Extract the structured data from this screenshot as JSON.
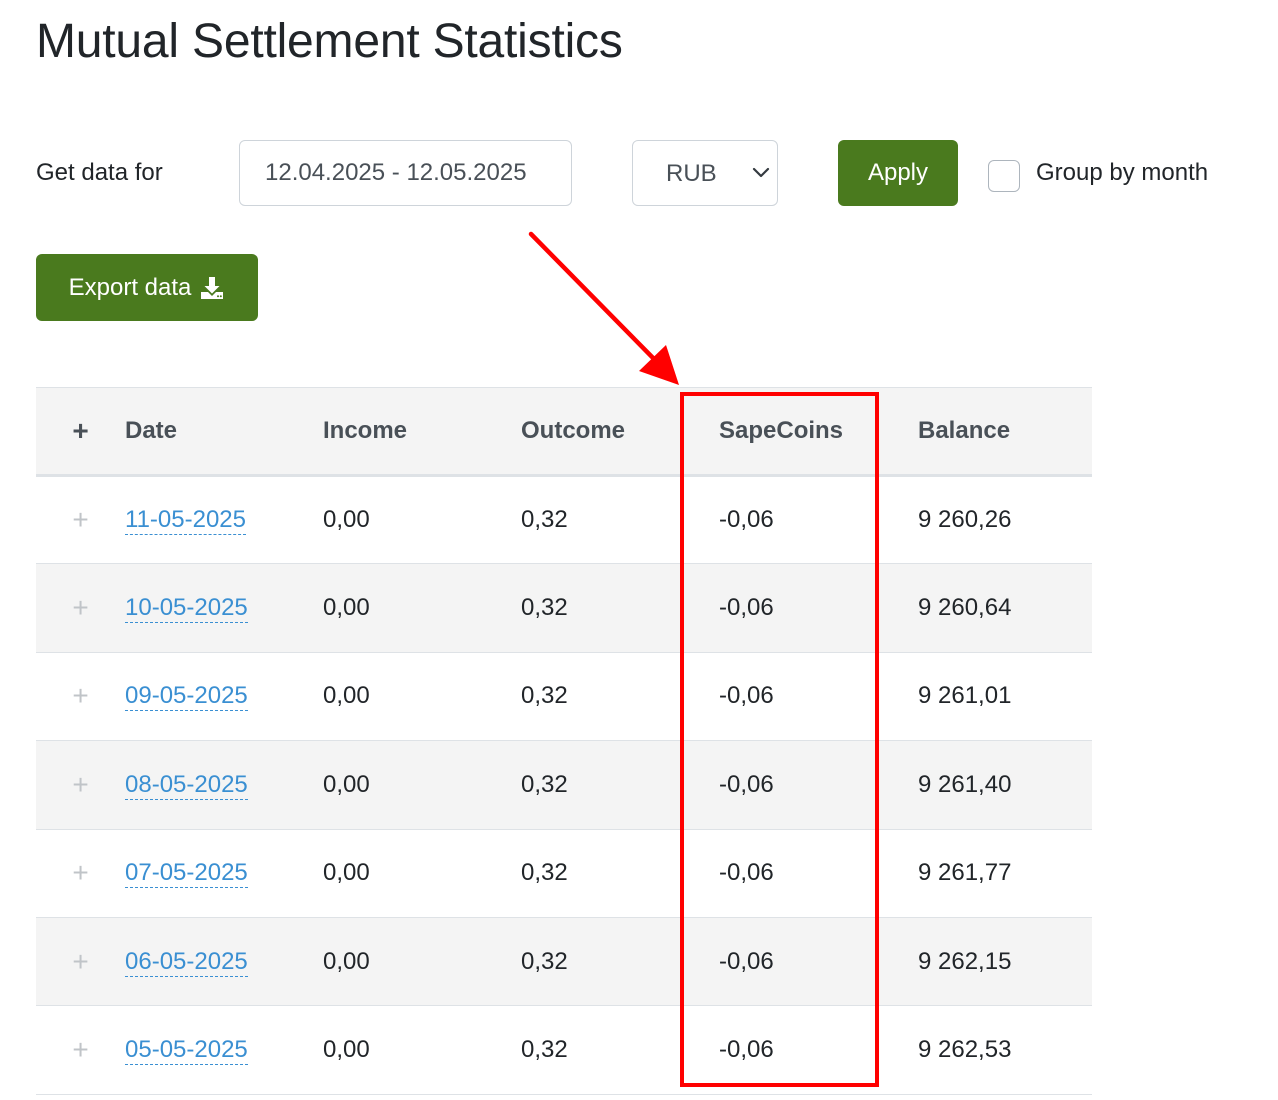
{
  "page": {
    "title": "Mutual Settlement Statistics"
  },
  "filters": {
    "label": "Get data for",
    "date_range": "12.04.2025 - 12.05.2025",
    "currency": "RUB",
    "apply_label": "Apply",
    "group_by_month_label": "Group by month",
    "group_by_month_checked": false
  },
  "export": {
    "label": "Export data",
    "icon": "download-icon"
  },
  "table": {
    "headers": {
      "expand": "+",
      "date": "Date",
      "income": "Income",
      "outcome": "Outcome",
      "sapecoins": "SapeCoins",
      "balance": "Balance"
    },
    "rows": [
      {
        "expand": "+",
        "date": "11-05-2025",
        "income": "0,00",
        "outcome": "0,32",
        "sapecoins": "-0,06",
        "balance": "9 260,26"
      },
      {
        "expand": "+",
        "date": "10-05-2025",
        "income": "0,00",
        "outcome": "0,32",
        "sapecoins": "-0,06",
        "balance": "9 260,64"
      },
      {
        "expand": "+",
        "date": "09-05-2025",
        "income": "0,00",
        "outcome": "0,32",
        "sapecoins": "-0,06",
        "balance": "9 261,01"
      },
      {
        "expand": "+",
        "date": "08-05-2025",
        "income": "0,00",
        "outcome": "0,32",
        "sapecoins": "-0,06",
        "balance": "9 261,40"
      },
      {
        "expand": "+",
        "date": "07-05-2025",
        "income": "0,00",
        "outcome": "0,32",
        "sapecoins": "-0,06",
        "balance": "9 261,77"
      },
      {
        "expand": "+",
        "date": "06-05-2025",
        "income": "0,00",
        "outcome": "0,32",
        "sapecoins": "-0,06",
        "balance": "9 262,15"
      },
      {
        "expand": "+",
        "date": "05-05-2025",
        "income": "0,00",
        "outcome": "0,32",
        "sapecoins": "-0,06",
        "balance": "9 262,53"
      }
    ]
  },
  "colors": {
    "primary_button": "#4a7a1e",
    "link": "#3a8fd2",
    "annotation": "#ff0000",
    "striped_row": "#f4f4f4"
  }
}
